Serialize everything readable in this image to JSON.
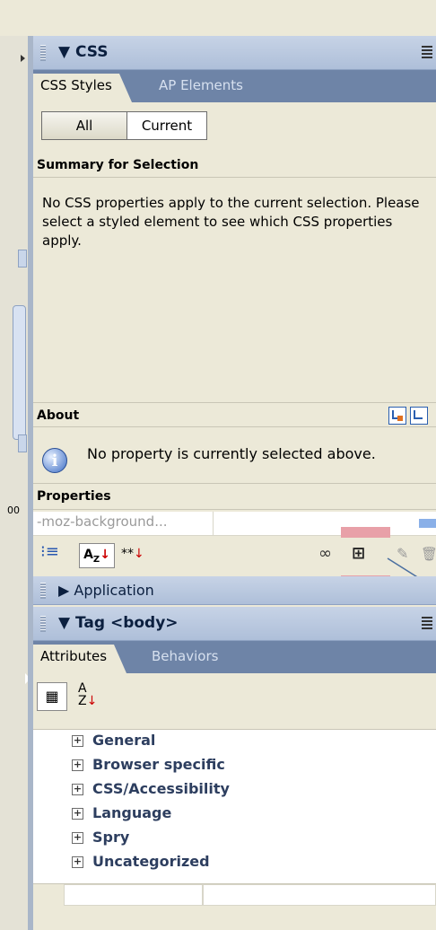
{
  "css_panel": {
    "title": "CSS",
    "tabs": [
      "CSS Styles",
      "AP Elements"
    ],
    "mode_buttons": [
      "All",
      "Current"
    ],
    "summary_title": "Summary for Selection",
    "summary_text": "No CSS properties apply to the current selection.  Please select a styled element to see which CSS properties apply.",
    "about_title": "About",
    "about_text": "No property is currently selected above.",
    "properties_title": "Properties",
    "property_name": "-moz-background..."
  },
  "application_panel": {
    "title": "Application"
  },
  "tag_panel": {
    "title": "Tag <body>",
    "tabs": [
      "Attributes",
      "Behaviors"
    ],
    "categories": [
      "General",
      "Browser specific",
      "CSS/Accessibility",
      "Language",
      "Spry",
      "Uncategorized"
    ]
  },
  "left_pane": {
    "truncated_label": "00"
  },
  "icons": {
    "css_toolbar": [
      "show-category-view-icon",
      "show-alpha-view-icon",
      "show-set-properties-icon",
      "attach-style-sheet-icon",
      "new-css-rule-icon",
      "edit-style-icon",
      "delete-css-rule-icon"
    ],
    "tag_toolbar": [
      "category-view-icon",
      "sort-az-icon"
    ]
  },
  "colors": {
    "panel_header": "#aebfd9",
    "tab_strip": "#6e84a7",
    "panel_bg": "#ece9d8",
    "highlight": "#e8a0a8"
  }
}
